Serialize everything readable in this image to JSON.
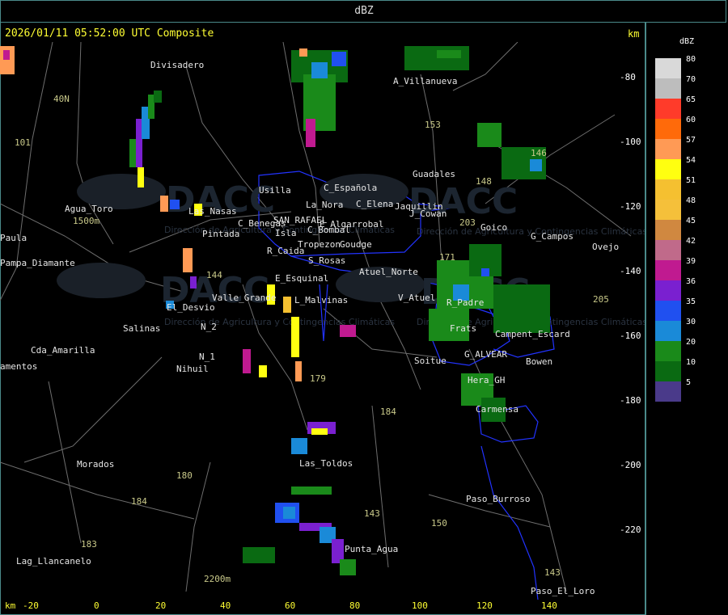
{
  "window": {
    "title": "dBZ"
  },
  "header": {
    "timestamp_text": "2026/01/11 05:52:00 UTC Composite",
    "km_label": "km"
  },
  "legend": {
    "title": "dBZ",
    "levels": [
      {
        "value": "80",
        "color": "#d9d9d9"
      },
      {
        "value": "70",
        "color": "#bdbdbd"
      },
      {
        "value": "65",
        "color": "#ff3b2a"
      },
      {
        "value": "60",
        "color": "#ff6a0a"
      },
      {
        "value": "57",
        "color": "#ff9a55"
      },
      {
        "value": "54",
        "color": "#ffff10"
      },
      {
        "value": "51",
        "color": "#f5c030"
      },
      {
        "value": "48",
        "color": "#f5c03a"
      },
      {
        "value": "45",
        "color": "#d08840"
      },
      {
        "value": "42",
        "color": "#c06a8a"
      },
      {
        "value": "39",
        "color": "#c01a90"
      },
      {
        "value": "36",
        "color": "#7a20d0"
      },
      {
        "value": "35",
        "color": "#2050f0"
      },
      {
        "value": "30",
        "color": "#1a8ad8"
      },
      {
        "value": "20",
        "color": "#1a8a1a"
      },
      {
        "value": "10",
        "color": "#0a6a12"
      },
      {
        "value": "5",
        "color": "#4a3a8a"
      }
    ]
  },
  "axes": {
    "y_ticks": [
      "-80",
      "-100",
      "-120",
      "-140",
      "-160",
      "-180",
      "-200",
      "-220"
    ],
    "x_unit": "km",
    "x_ticks": [
      "-20",
      "0",
      "20",
      "40",
      "60",
      "80",
      "100",
      "120",
      "140"
    ]
  },
  "places": [
    "Divisadero",
    "A_Villanueva",
    "Usilla",
    "La_Nora",
    "C_Española",
    "C_Elena",
    "Jaquillin",
    "J_Cowan",
    "Guadales",
    "Goico",
    "G_Campos",
    "Ovejo",
    "Agua_Toro",
    "Las_Nasas",
    "Pintada",
    "C_Benegas",
    "SAN_RAFAEL",
    "E_Algarrobal",
    "C_Bombal",
    "Isla",
    "Tropezon",
    "Goudge",
    "R_Caida",
    "S_Rosas",
    "Atuel_Norte",
    "E_Esquinal",
    "Valle_Grande",
    "L_Malvinas",
    "El_Desvio",
    "Salinas",
    "N_2",
    "N_1",
    "Nihuil",
    "V_Atuel",
    "R_Padre",
    "Frats",
    "Campent_Escard",
    "G_ALVEAR",
    "Soitue",
    "Bowen",
    "Hera_GH",
    "Carmensa",
    "Las_Toldos",
    "Paso_Burroso",
    "Punta_Agua",
    "Paso_El_Loro",
    "Morados",
    "Cda_Amarilla",
    "Pampa_Diamante",
    "Lag_Llancanelo",
    "Paula",
    "amentos",
    "1500m",
    "2200m",
    "40N",
    "Ovejo"
  ],
  "routes": [
    "101",
    "40N",
    "153",
    "148",
    "146",
    "203",
    "171",
    "143",
    "144",
    "179",
    "184",
    "180",
    "150",
    "183",
    "205",
    "184",
    "143"
  ],
  "watermark": {
    "brand": "DACC",
    "subtitle": "Dirección de Agricultura y Contingencias Climáticas"
  },
  "colors": {
    "border": "#4a8a8a",
    "header_text": "#ffff33",
    "boundary_blue": "#2233ff",
    "road_gray": "#808080"
  }
}
